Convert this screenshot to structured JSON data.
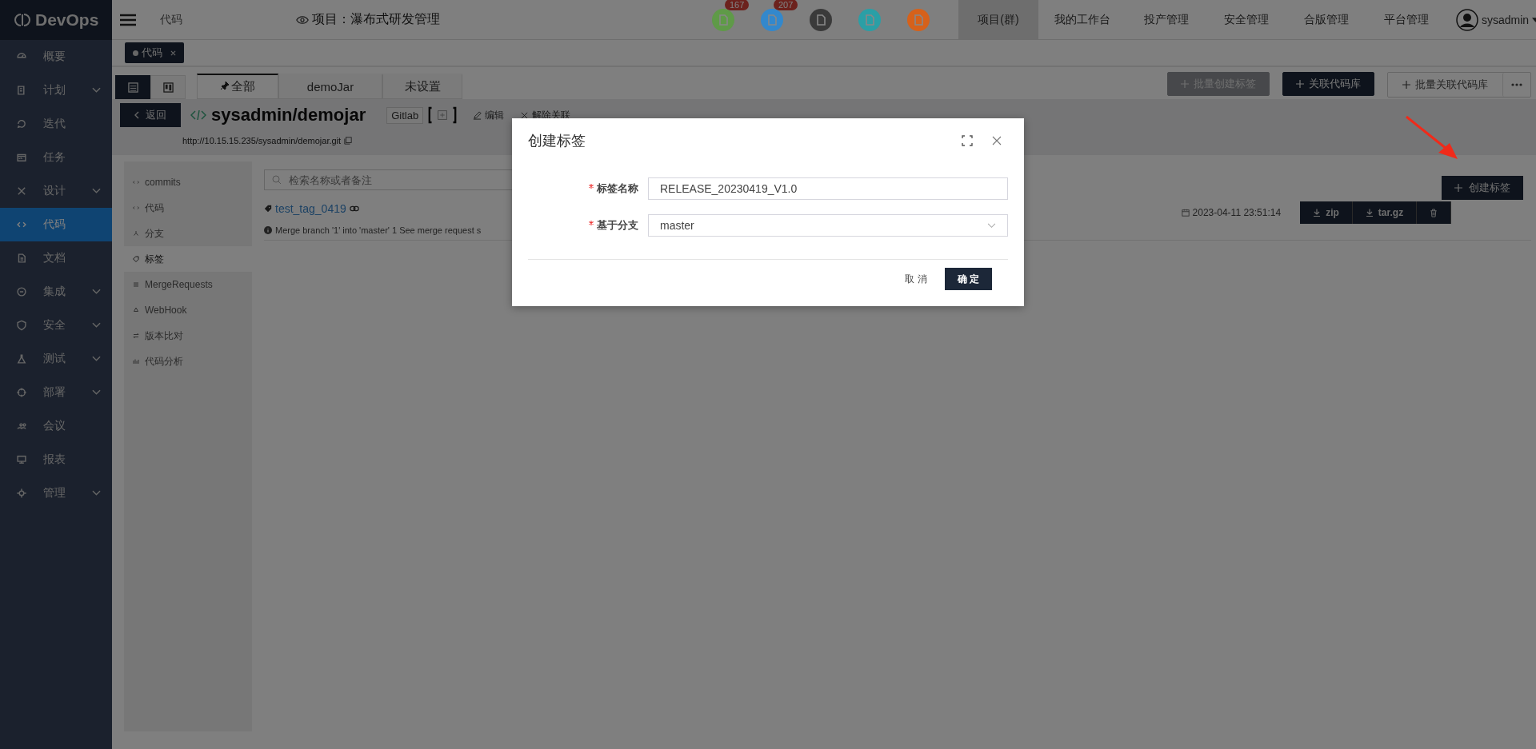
{
  "app": {
    "logo": "DevOps"
  },
  "sidebar": {
    "items": [
      {
        "label": "概要",
        "expandable": false,
        "selected": false
      },
      {
        "label": "计划",
        "expandable": true,
        "selected": false
      },
      {
        "label": "迭代",
        "expandable": false,
        "selected": false
      },
      {
        "label": "任务",
        "expandable": false,
        "selected": false
      },
      {
        "label": "设计",
        "expandable": true,
        "selected": false
      },
      {
        "label": "代码",
        "expandable": false,
        "selected": true
      },
      {
        "label": "文档",
        "expandable": false,
        "selected": false
      },
      {
        "label": "集成",
        "expandable": true,
        "selected": false
      },
      {
        "label": "安全",
        "expandable": true,
        "selected": false
      },
      {
        "label": "测试",
        "expandable": true,
        "selected": false
      },
      {
        "label": "部署",
        "expandable": true,
        "selected": false
      },
      {
        "label": "会议",
        "expandable": false,
        "selected": false
      },
      {
        "label": "报表",
        "expandable": false,
        "selected": false
      },
      {
        "label": "管理",
        "expandable": true,
        "selected": false
      }
    ]
  },
  "topbar": {
    "breadcrumb": "代码",
    "project": "项目：瀑布式研发管理",
    "quick_icons": [
      {
        "color": "#5f9a48",
        "badge": "167"
      },
      {
        "color": "#3388cc",
        "badge": "207"
      },
      {
        "color": "#3a3a3a"
      },
      {
        "color": "#2a9fa6"
      },
      {
        "color": "#d6611a"
      }
    ],
    "nav": [
      {
        "label": "项目(群)",
        "selected": true
      },
      {
        "label": "我的工作台",
        "selected": false
      },
      {
        "label": "投产管理",
        "selected": false
      },
      {
        "label": "安全管理",
        "selected": false
      },
      {
        "label": "合版管理",
        "selected": false
      },
      {
        "label": "平台管理",
        "selected": false
      }
    ],
    "user": "sysadmin"
  },
  "open_tabs": [
    {
      "label": "代码"
    }
  ],
  "view_toggle": [
    {
      "selected": true
    },
    {
      "selected": false
    }
  ],
  "filter_tabs": [
    {
      "label": "全部",
      "selected": true,
      "pinned": true
    },
    {
      "label": "demoJar",
      "selected": false,
      "pinned": false
    },
    {
      "label": "未设置",
      "selected": false,
      "pinned": false
    }
  ],
  "toolbar_buttons": [
    {
      "label": "批量创建标签",
      "kind": "disabled"
    },
    {
      "label": "关联代码库",
      "kind": "primary"
    },
    {
      "label": "批量关联代码库",
      "kind": "outline"
    }
  ],
  "repo": {
    "back": "返回",
    "name": "sysadmin/demojar",
    "source": "Gitlab",
    "actions": [
      "编辑",
      "解除关联"
    ],
    "url": "http://10.15.15.235/sysadmin/demojar.git"
  },
  "repo_nav": [
    {
      "label": "commits",
      "selected": false
    },
    {
      "label": "代码",
      "selected": false
    },
    {
      "label": "分支",
      "selected": false
    },
    {
      "label": "标签",
      "selected": true
    },
    {
      "label": "MergeRequests",
      "selected": false
    },
    {
      "label": "WebHook",
      "selected": false
    },
    {
      "label": "版本比对",
      "selected": false
    },
    {
      "label": "代码分析",
      "selected": false
    }
  ],
  "search": {
    "placeholder": "检索名称或者备注"
  },
  "create_button": "创建标签",
  "tags": [
    {
      "name": "test_tag_0419",
      "message": "Merge branch '1' into 'master' 1 See merge request s",
      "date": "2023-04-11 23:51:14",
      "downloads": [
        "zip",
        "tar.gz"
      ]
    }
  ],
  "dialog": {
    "title": "创建标签",
    "fields": [
      {
        "label": "标签名称",
        "required": true,
        "kind": "text",
        "value": "RELEASE_20230419_V1.0"
      },
      {
        "label": "基于分支",
        "required": true,
        "kind": "select",
        "value": "master"
      }
    ],
    "cancel": "取 消",
    "ok": "确 定"
  }
}
